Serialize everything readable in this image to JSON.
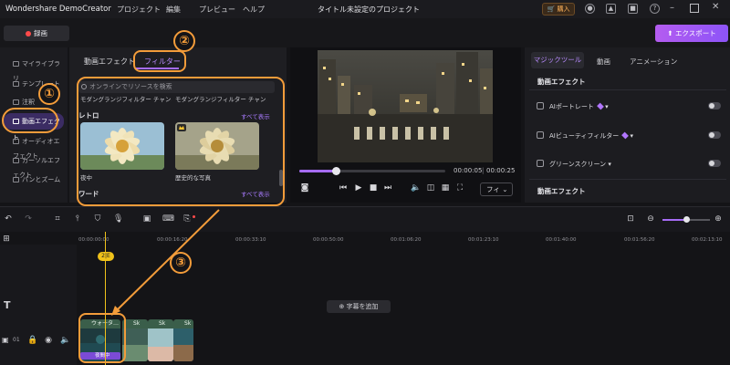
{
  "titlebar": {
    "brand": "Wondershare DemoCreator",
    "menus": [
      "プロジェクト",
      "編集",
      "プレビュー",
      "ヘルプ"
    ],
    "document_title": "タイトル未設定のプロジェクト",
    "buy_label": "購入"
  },
  "toolbar": {
    "record_label": "録画",
    "export_label": "エクスポート"
  },
  "sidebar": {
    "items": [
      {
        "label": "マイライブラリ"
      },
      {
        "label": "テンプレート"
      },
      {
        "label": "注釈"
      },
      {
        "label": "動画エフェクト"
      },
      {
        "label": "オーディオエフェクト"
      },
      {
        "label": "カーソルエフェクト"
      },
      {
        "label": "パンとズーム"
      }
    ],
    "active_index": 3
  },
  "effects_panel": {
    "tabs": [
      "動画エフェクト",
      "フィルター"
    ],
    "active_tab": "フィルター",
    "search_placeholder": "オンラインでリソースを検索",
    "cut_labels": [
      "モダングランジフィルター チャンネ…",
      "モダングランジフィルター チャンネ…"
    ],
    "sections": [
      {
        "title": "レトロ",
        "show_all": "すべて表示",
        "items": [
          {
            "caption": "夜中"
          },
          {
            "caption": "歴史的な写真"
          }
        ]
      },
      {
        "title": "ワード",
        "show_all": "すべて表示"
      }
    ]
  },
  "player": {
    "current_time": "00:00:05",
    "total_time": "00:00:25",
    "progress_fraction": 0.25,
    "fit_label": "フィ"
  },
  "properties": {
    "tabs": [
      "マジックツール",
      "動画",
      "アニメーション"
    ],
    "active_tab": "マジックツール",
    "section1": "動画エフェクト",
    "rows": [
      {
        "label": "AIポートレート"
      },
      {
        "label": "AIビューティフィルター"
      },
      {
        "label": "グリーンスクリーン"
      }
    ],
    "section2": "動画エフェクト"
  },
  "timeline": {
    "ruler": [
      "00:00:00:00",
      "00:00:16:20",
      "00:00:33:10",
      "00:00:50:00",
      "00:01:06:20",
      "00:01:23:10",
      "00:01:40:00",
      "00:01:56:20",
      "00:02:13:10"
    ],
    "playhead_label": "2|E",
    "caption_button": "字幕を追加",
    "track_label": "01",
    "clips": [
      {
        "label": "ウォータ…"
      },
      {
        "label": "Sk"
      },
      {
        "label": "Sk"
      },
      {
        "label": "Sk"
      }
    ],
    "filter_tag": "夜間中"
  },
  "annotations": {
    "badges": [
      "①",
      "②",
      "③"
    ],
    "accent_color": "#f39c3a"
  }
}
